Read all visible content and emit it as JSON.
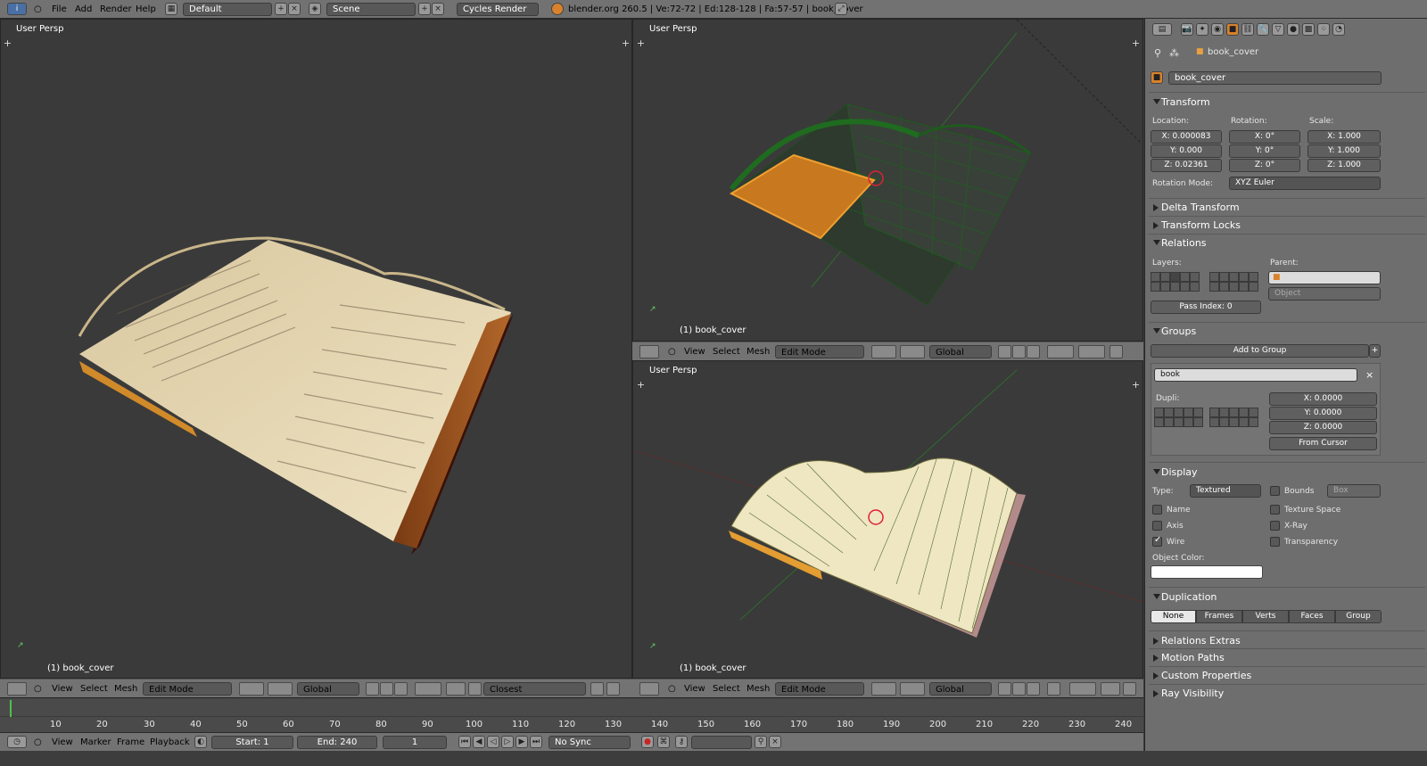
{
  "topbar": {
    "menus": [
      "File",
      "Add",
      "Render",
      "Help"
    ],
    "layout": "Default",
    "scene": "Scene",
    "engine": "Cycles Render",
    "stats": "blender.org 260.5 | Ve:72-72 | Ed:128-128 | Fa:57-57 | book_cover"
  },
  "viewports": {
    "left": {
      "label": "User Persp",
      "object": "(1) book_cover"
    },
    "top_right": {
      "label": "User Persp",
      "object": "(1) book_cover"
    },
    "bottom_right": {
      "label": "User Persp",
      "object": "(1) book_cover"
    }
  },
  "vp_header": {
    "view": "View",
    "select": "Select",
    "mesh": "Mesh",
    "mode": "Edit Mode",
    "orientation": "Global",
    "snap": "Closest"
  },
  "timeline": {
    "ticks": [
      "10",
      "20",
      "30",
      "40",
      "50",
      "60",
      "70",
      "80",
      "90",
      "100",
      "110",
      "120",
      "130",
      "140",
      "150",
      "160",
      "170",
      "180",
      "190",
      "200",
      "210",
      "220",
      "230",
      "240"
    ],
    "view": "View",
    "marker": "Marker",
    "frame": "Frame",
    "playback": "Playback",
    "start": "Start: 1",
    "end": "End: 240",
    "current": "1",
    "sync": "No Sync"
  },
  "props": {
    "breadcrumb": "book_cover",
    "name": "book_cover",
    "transform": {
      "title": "Transform",
      "location": "Location:",
      "rotation": "Rotation:",
      "scale": "Scale:",
      "loc": [
        "X: 0.000083",
        "Y: 0.000",
        "Z: 0.02361"
      ],
      "rot": [
        "X: 0°",
        "Y: 0°",
        "Z: 0°"
      ],
      "scl": [
        "X: 1.000",
        "Y: 1.000",
        "Z: 1.000"
      ],
      "rot_mode_label": "Rotation Mode:",
      "rot_mode": "XYZ Euler"
    },
    "delta": "Delta Transform",
    "locks": "Transform Locks",
    "relations": {
      "title": "Relations",
      "layers": "Layers:",
      "parent": "Parent:",
      "parent_type": "Object",
      "pass_index": "Pass Index: 0"
    },
    "groups": {
      "title": "Groups",
      "add": "Add to Group",
      "group_name": "book",
      "dupli": "Dupli:",
      "dupli_xyz": [
        "X: 0.0000",
        "Y: 0.0000",
        "Z: 0.0000"
      ],
      "from_cursor": "From Cursor"
    },
    "display": {
      "title": "Display",
      "type_label": "Type:",
      "type": "Textured",
      "bounds": "Bounds",
      "bounds_type": "Box",
      "name": "Name",
      "texture_space": "Texture Space",
      "axis": "Axis",
      "xray": "X-Ray",
      "wire": "Wire",
      "transparency": "Transparency",
      "object_color": "Object Color:"
    },
    "duplication": {
      "title": "Duplication",
      "tabs": [
        "None",
        "Frames",
        "Verts",
        "Faces",
        "Group"
      ]
    },
    "relations_extras": "Relations Extras",
    "motion_paths": "Motion Paths",
    "custom_props": "Custom Properties",
    "ray_visibility": "Ray Visibility"
  }
}
